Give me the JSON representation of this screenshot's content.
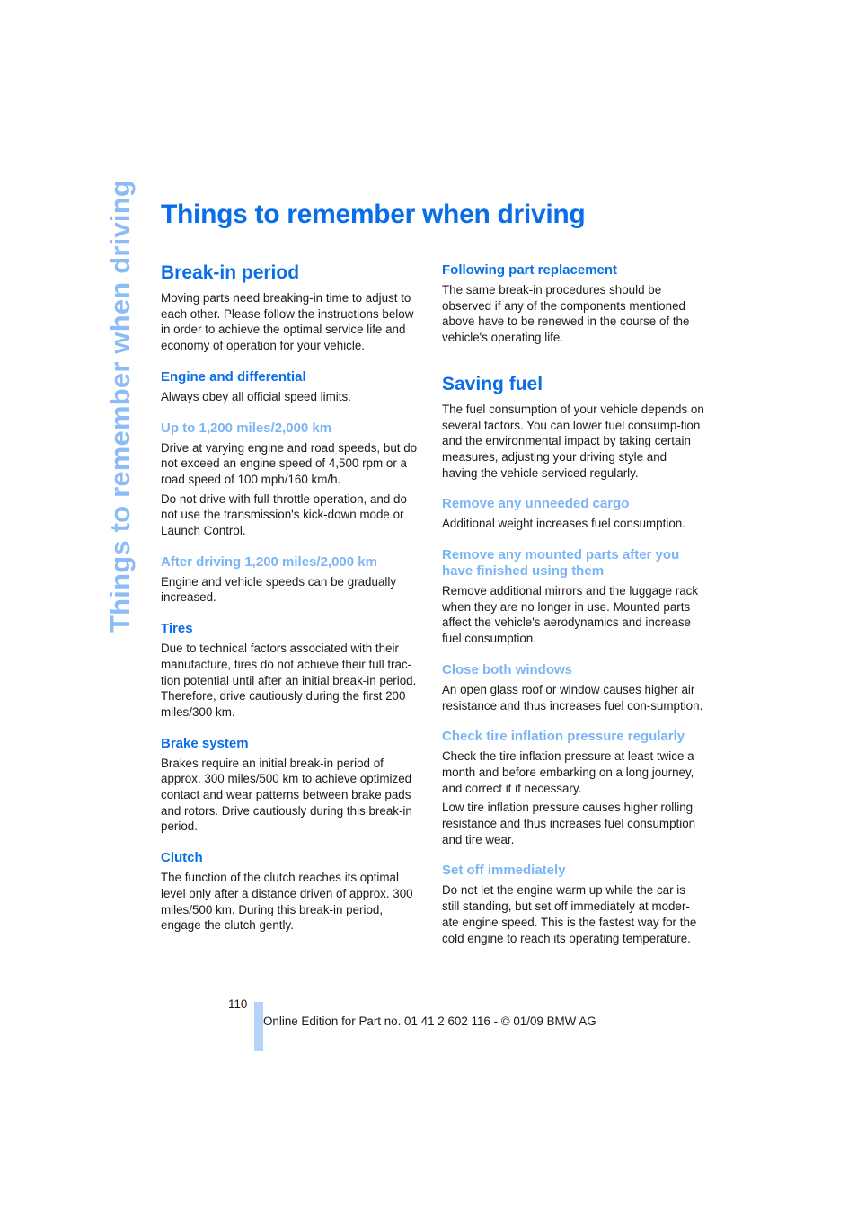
{
  "side_tab": "Things to remember when driving",
  "title": "Things to remember when driving",
  "left_column": {
    "heading": "Break-in period",
    "intro": "Moving parts need breaking-in time to adjust to each other. Please follow the instructions below in order to achieve the optimal service life and economy of operation for your vehicle.",
    "engine": {
      "heading": "Engine and differential",
      "text": "Always obey all official speed limits."
    },
    "upto": {
      "heading": "Up to 1,200 miles/2,000 km",
      "paragraphs": [
        "Drive at varying engine and road speeds, but do not exceed an engine speed of 4,500 rpm or a road speed of 100 mph/160 km/h.",
        "Do not drive with full-throttle operation, and do not use the transmission's kick-down mode or Launch Control."
      ]
    },
    "after": {
      "heading": "After driving 1,200 miles/2,000 km",
      "text": "Engine and vehicle speeds can be gradually increased."
    },
    "tires": {
      "heading": "Tires",
      "text": "Due to technical factors associated with their manufacture, tires do not achieve their full trac-tion potential until after an initial break-in period. Therefore, drive cautiously during the first 200 miles/300 km."
    },
    "brakes": {
      "heading": "Brake system",
      "text": "Brakes require an initial break-in period of approx. 300 miles/500 km to achieve optimized contact and wear patterns between brake pads and rotors. Drive cautiously during this break-in period."
    },
    "clutch": {
      "heading": "Clutch",
      "text": "The function of the clutch reaches its optimal level only after a distance driven of approx. 300 miles/500 km. During this break-in period, engage the clutch gently."
    }
  },
  "right_column": {
    "replacement": {
      "heading": "Following part replacement",
      "text": "The same break-in procedures should be observed if any of the components mentioned above have to be renewed in the course of the vehicle's operating life."
    },
    "saving": {
      "heading": "Saving fuel",
      "intro": "The fuel consumption of your vehicle depends on several factors. You can lower fuel consump-tion and the environmental impact by taking certain measures, adjusting your driving style and having the vehicle serviced regularly."
    },
    "cargo": {
      "heading": "Remove any unneeded cargo",
      "text": "Additional weight increases fuel consumption."
    },
    "mounted": {
      "heading": "Remove any mounted parts after you have finished using them",
      "text": "Remove additional mirrors and the luggage rack when they are no longer in use. Mounted parts affect the vehicle's aerodynamics and increase fuel consumption."
    },
    "windows": {
      "heading": "Close both windows",
      "text": "An open glass roof or window causes higher air resistance and thus increases fuel con-sumption."
    },
    "pressure": {
      "heading": "Check tire inflation pressure regularly",
      "paragraphs": [
        "Check the tire inflation pressure at least twice a month and before embarking on a long journey, and correct it if necessary.",
        "Low tire inflation pressure causes higher rolling resistance and thus increases fuel consumption and tire wear."
      ]
    },
    "setoff": {
      "heading": "Set off immediately",
      "text": "Do not let the engine warm up while the car is still standing, but set off immediately at moder-ate engine speed. This is the fastest way for the cold engine to reach its operating temperature."
    }
  },
  "footer": {
    "page_number": "110",
    "text": "Online Edition for Part no. 01 41 2 602 116 - © 01/09 BMW AG"
  }
}
